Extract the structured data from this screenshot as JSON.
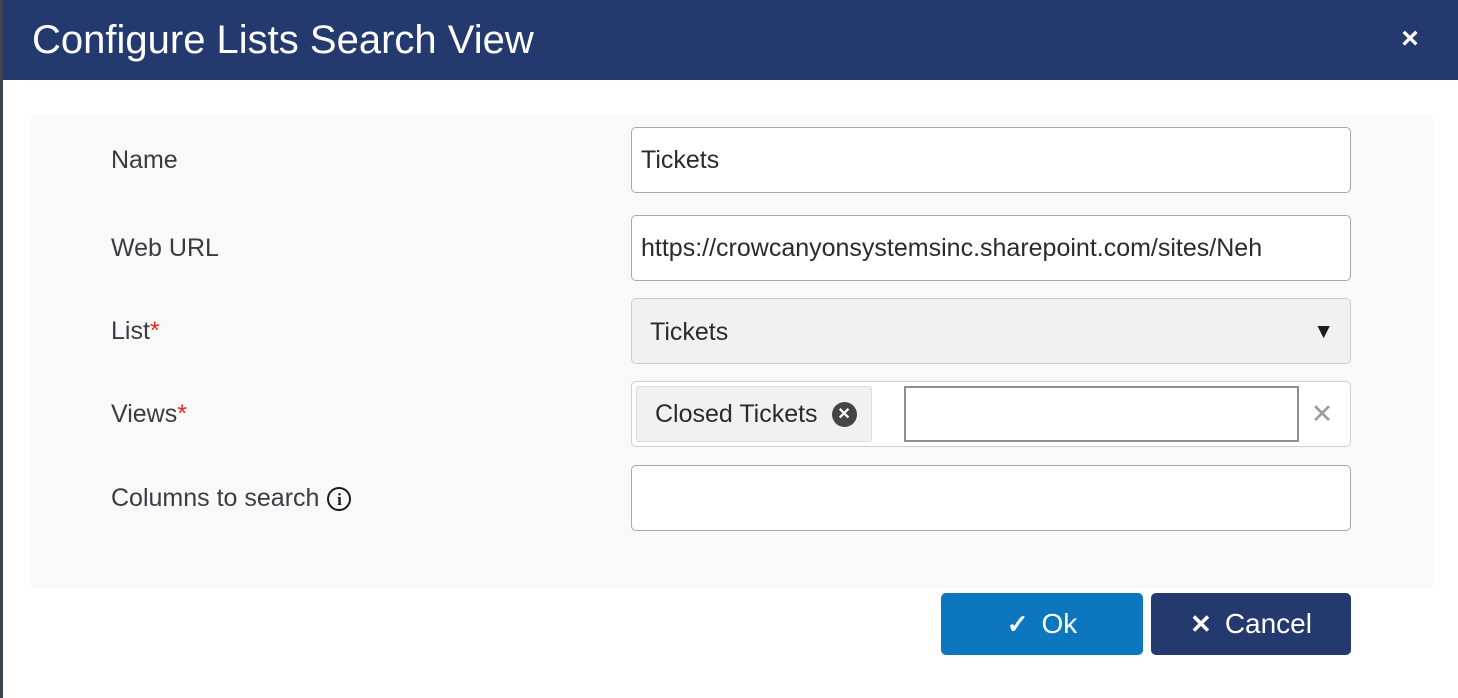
{
  "dialog": {
    "title": "Configure Lists Search View",
    "close_label": "×",
    "header_color": "#243a6e"
  },
  "form": {
    "fields": [
      {
        "label": "Name",
        "required": false,
        "type": "text",
        "value": "Tickets",
        "placeholder": ""
      },
      {
        "label": "Web URL",
        "required": false,
        "type": "text",
        "value": "https://crowcanyonsystemsinc.sharepoint.com/sites/Neh",
        "placeholder": ""
      },
      {
        "label": "List",
        "required": true,
        "required_marker": "*",
        "type": "select",
        "value": "Tickets",
        "caret": "▼"
      },
      {
        "label": "Views",
        "required": true,
        "required_marker": "*",
        "type": "multiselect",
        "chips": [
          {
            "label": "Closed Tickets",
            "remove_glyph": "✕"
          }
        ],
        "input_value": "",
        "placeholder": "",
        "clear_glyph": "✕"
      },
      {
        "label": "Columns to search",
        "required": false,
        "type": "text",
        "value": "",
        "placeholder": "",
        "info_icon": "i",
        "has_info": true
      }
    ],
    "required_color": "#ee2222",
    "panel_color": "#f9f9f9"
  },
  "footer": {
    "ok_label": "Ok",
    "ok_glyph": "✓",
    "ok_color": "#0c76bf",
    "cancel_label": "Cancel",
    "cancel_glyph": "✕",
    "cancel_color": "#243a6e"
  }
}
